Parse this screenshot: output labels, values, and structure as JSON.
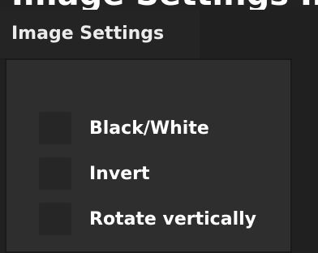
{
  "banner": {
    "text": "Image Settings Image Settings"
  },
  "tab": {
    "label": "Image Settings"
  },
  "options": [
    {
      "label": "Black/White",
      "checked": false
    },
    {
      "label": "Invert",
      "checked": false
    },
    {
      "label": "Rotate vertically",
      "checked": false
    }
  ]
}
